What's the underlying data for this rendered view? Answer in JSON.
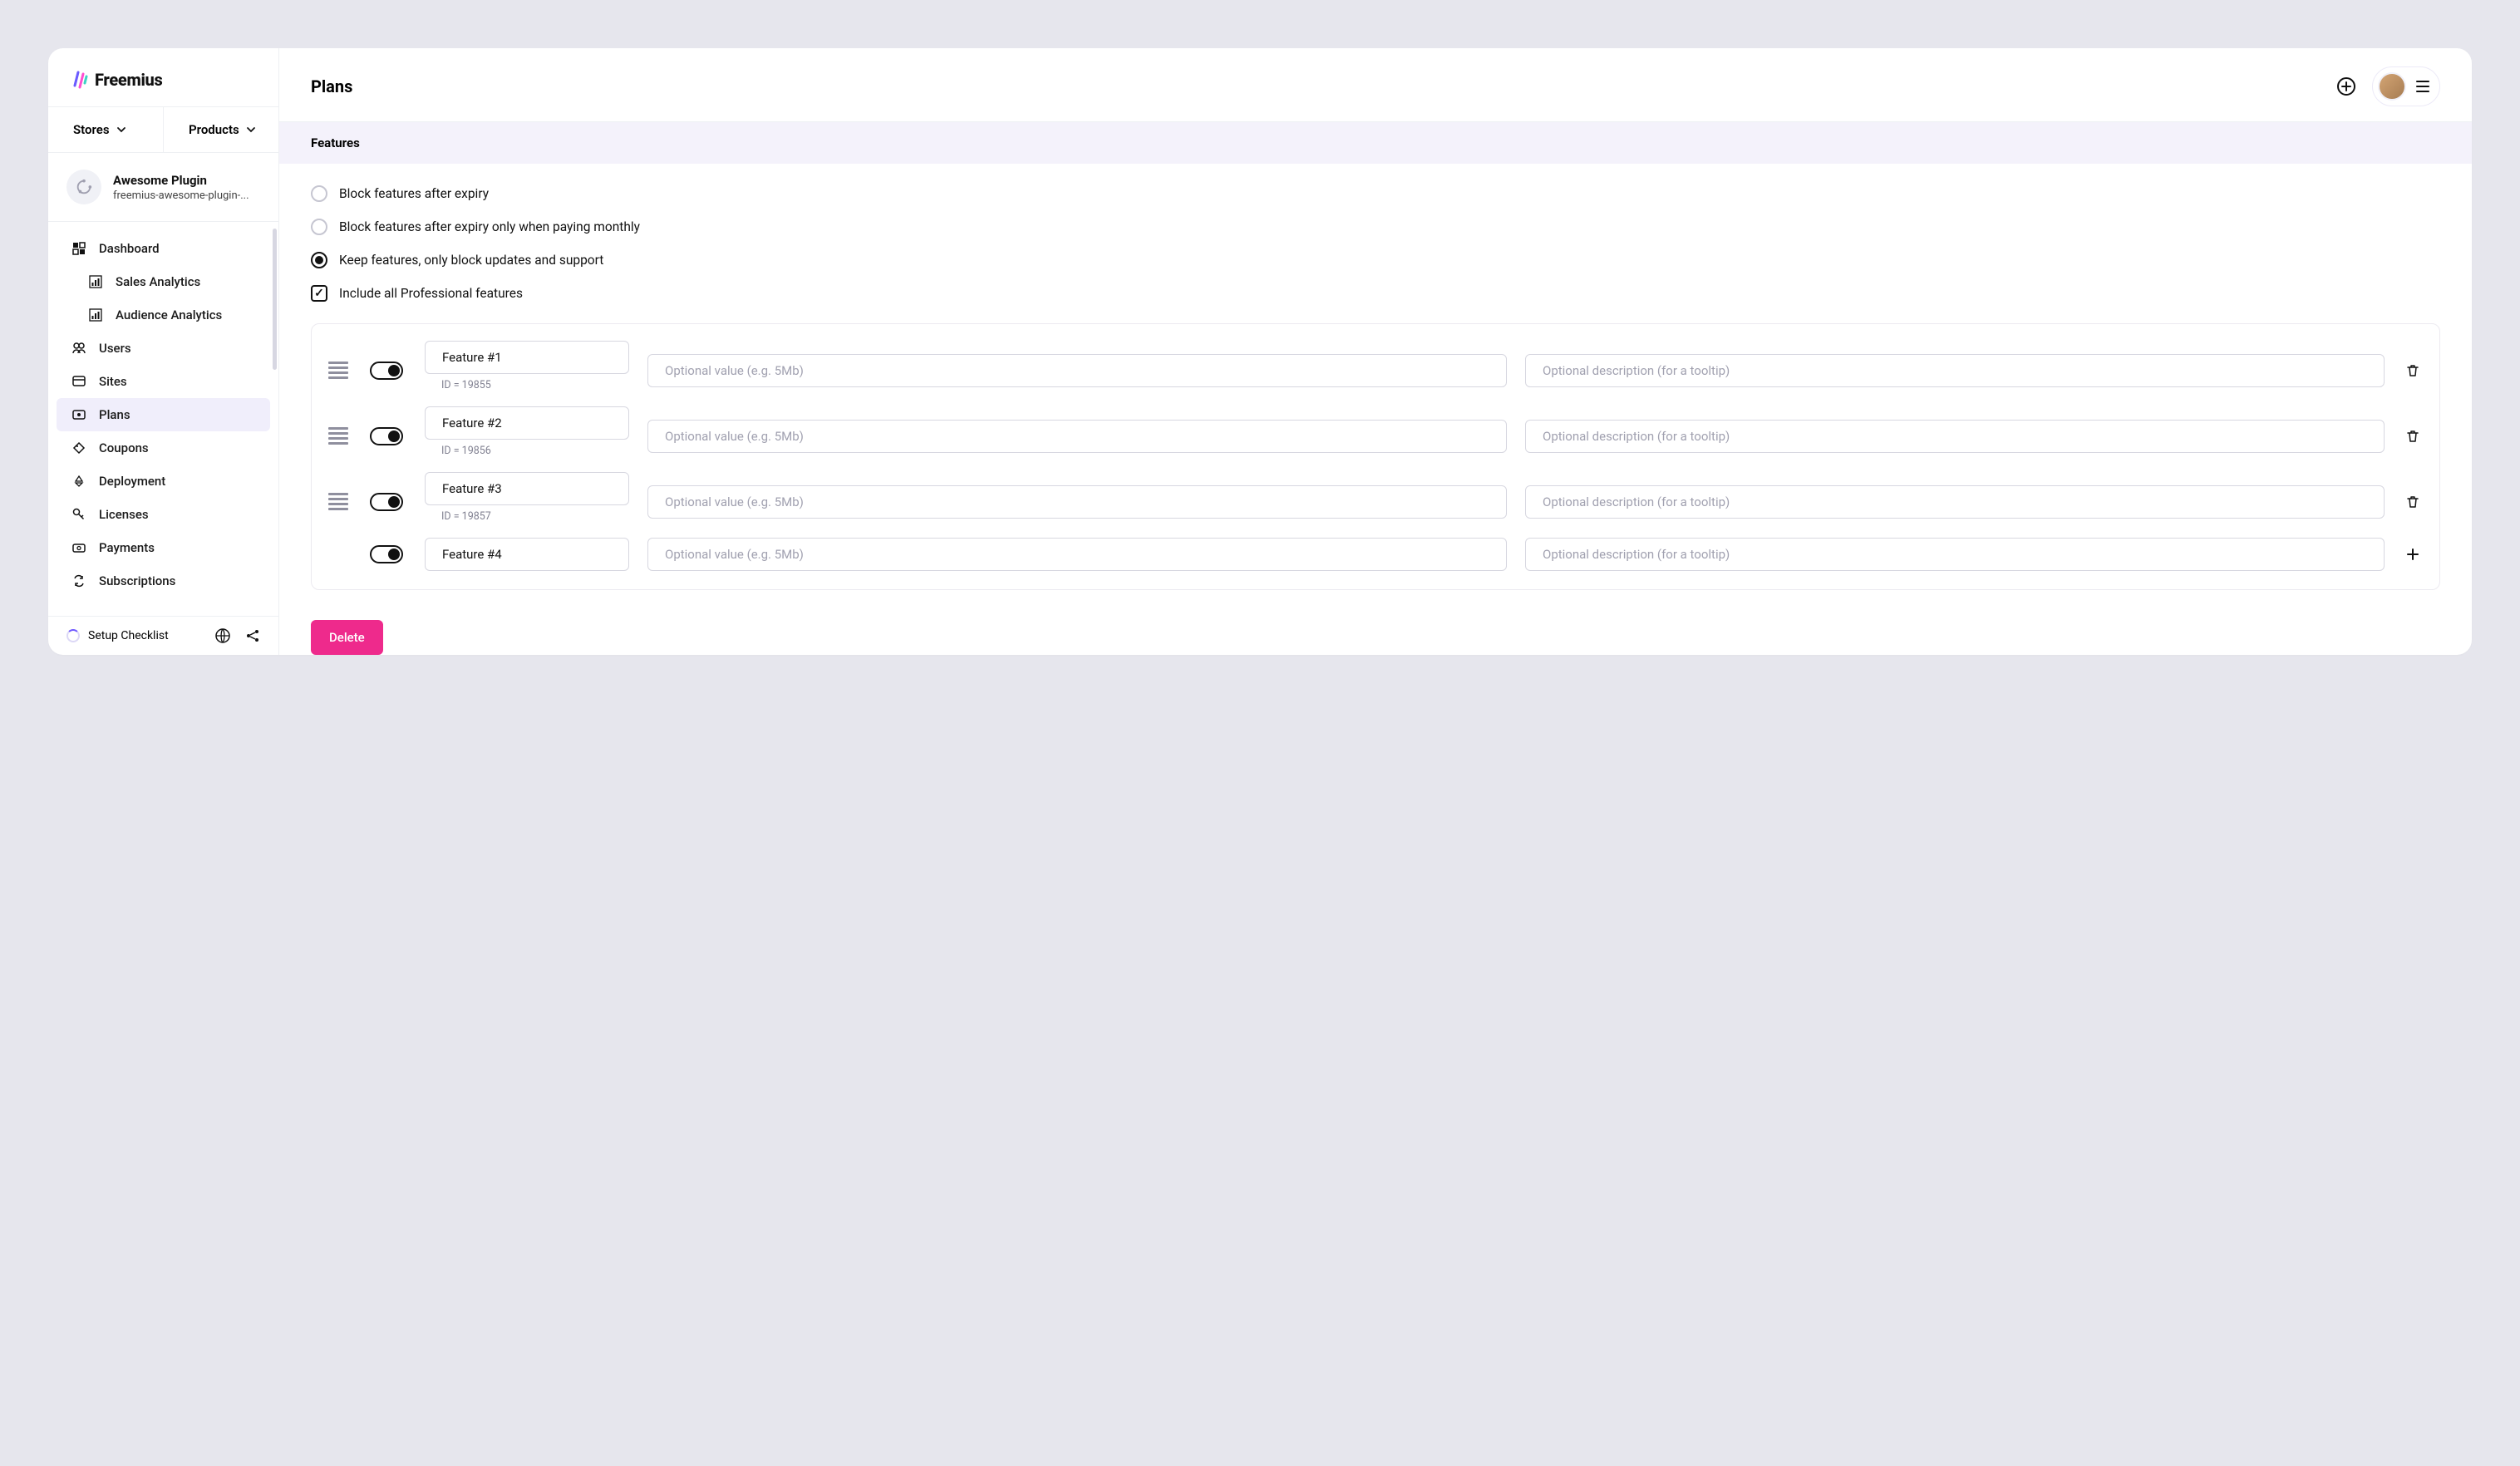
{
  "brand": {
    "name": "Freemius"
  },
  "selectors": {
    "stores": "Stores",
    "products": "Products"
  },
  "product": {
    "name": "Awesome Plugin",
    "slug": "freemius-awesome-plugin-..."
  },
  "nav": {
    "dashboard": "Dashboard",
    "salesAnalytics": "Sales Analytics",
    "audienceAnalytics": "Audience Analytics",
    "users": "Users",
    "sites": "Sites",
    "plans": "Plans",
    "coupons": "Coupons",
    "deployment": "Deployment",
    "licenses": "Licenses",
    "payments": "Payments",
    "subscriptions": "Subscriptions"
  },
  "footer": {
    "setup": "Setup Checklist"
  },
  "header": {
    "title": "Plans"
  },
  "section": {
    "title": "Features"
  },
  "options": {
    "blockAfter": "Block features after expiry",
    "blockMonthly": "Block features after expiry only when paying monthly",
    "keepFeatures": "Keep features, only block updates and support",
    "includePro": "Include all Professional features"
  },
  "placeholders": {
    "value": "Optional value (e.g. 5Mb)",
    "description": "Optional description (for a tooltip)"
  },
  "features": [
    {
      "name": "Feature #1",
      "id": "ID = 19855"
    },
    {
      "name": "Feature #2",
      "id": "ID = 19856"
    },
    {
      "name": "Feature #3",
      "id": "ID = 19857"
    },
    {
      "name": "Feature #4",
      "id": ""
    }
  ],
  "delete": "Delete"
}
